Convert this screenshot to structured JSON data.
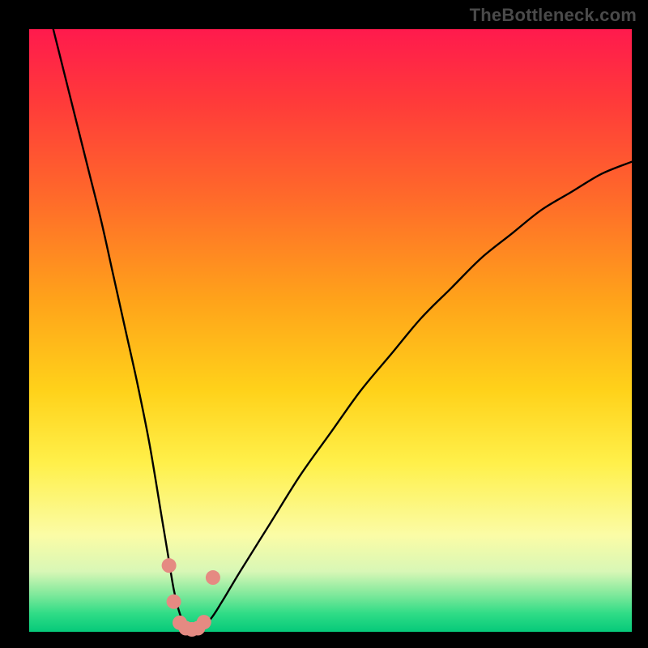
{
  "watermark": {
    "text": "TheBottleneck.com"
  },
  "colors": {
    "frame": "#000000",
    "curve": "#000000",
    "marker_fill": "#e58a82",
    "marker_stroke": "#e58a82",
    "gradient_stops": [
      "#ff1a4d",
      "#ff3a3a",
      "#ff6a2a",
      "#ffa31a",
      "#ffd21a",
      "#fff04a",
      "#fbfca6",
      "#d8f7b6",
      "#7be89a",
      "#2fdc86",
      "#06c97a"
    ]
  },
  "chart_data": {
    "type": "line",
    "title": "",
    "xlabel": "",
    "ylabel": "",
    "xlim": [
      0,
      100
    ],
    "ylim": [
      0,
      100
    ],
    "grid": false,
    "legend": false,
    "series": [
      {
        "name": "bottleneck-curve",
        "x": [
          4,
          6,
          8,
          10,
          12,
          14,
          16,
          18,
          20,
          22,
          23,
          24,
          25,
          26,
          27,
          28,
          30,
          32,
          35,
          40,
          45,
          50,
          55,
          60,
          65,
          70,
          75,
          80,
          85,
          90,
          95,
          100
        ],
        "y": [
          100,
          92,
          84,
          76,
          68,
          59,
          50,
          41,
          31,
          19,
          13,
          7,
          3,
          1,
          0,
          0.5,
          2,
          5,
          10,
          18,
          26,
          33,
          40,
          46,
          52,
          57,
          62,
          66,
          70,
          73,
          76,
          78
        ]
      }
    ],
    "markers": {
      "name": "floor-markers",
      "x": [
        23.2,
        24.0,
        25.0,
        26.0,
        27.0,
        28.0,
        29.0,
        30.5
      ],
      "y": [
        11.0,
        5.0,
        1.5,
        0.6,
        0.4,
        0.6,
        1.6,
        9.0
      ]
    }
  }
}
